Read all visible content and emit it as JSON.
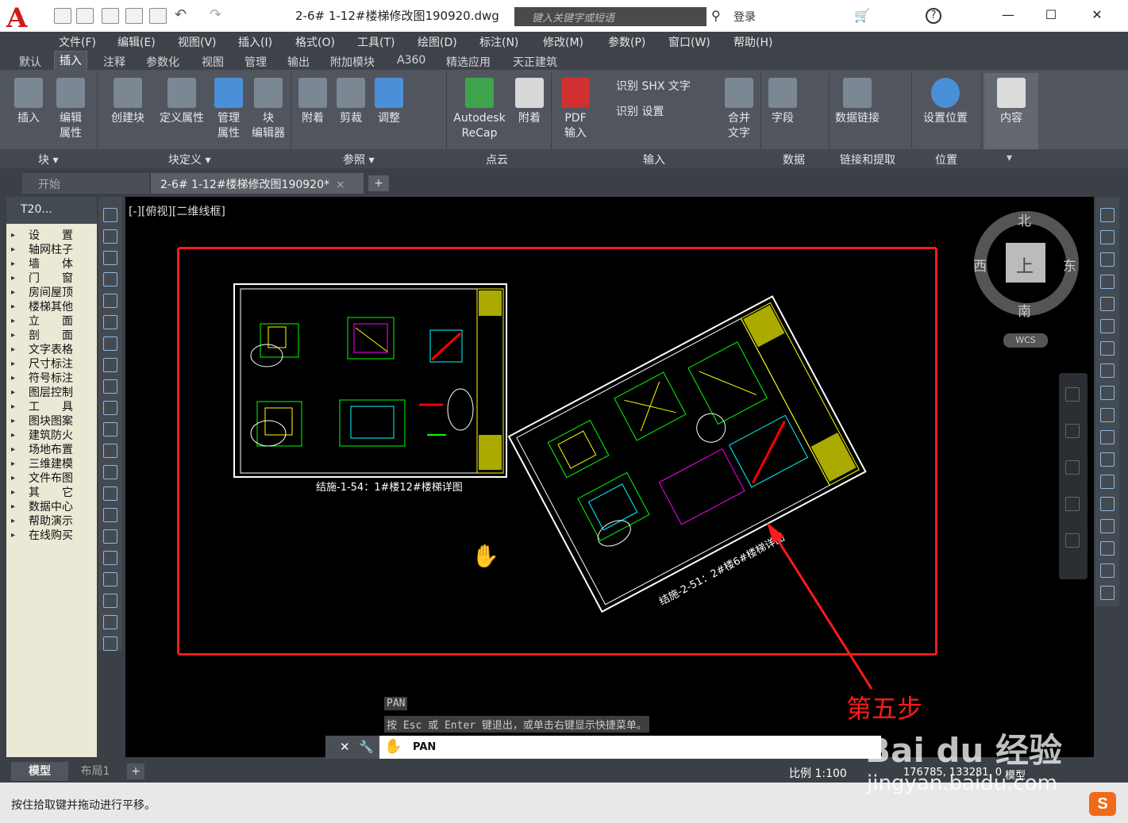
{
  "titlebar": {
    "doc_title": "2-6# 1-12#楼梯修改图190920.dwg",
    "search_placeholder": "键入关键字或短语",
    "signin": "登录"
  },
  "menubar": [
    "文件(F)",
    "编辑(E)",
    "视图(V)",
    "插入(I)",
    "格式(O)",
    "工具(T)",
    "绘图(D)",
    "标注(N)",
    "修改(M)",
    "参数(P)",
    "窗口(W)",
    "帮助(H)"
  ],
  "ribbon_tabs": [
    "默认",
    "插入",
    "注释",
    "参数化",
    "视图",
    "管理",
    "输出",
    "附加模块",
    "A360",
    "精选应用",
    "天正建筑"
  ],
  "ribbon": {
    "insert": "插入",
    "edit_attr": "编辑\n属性",
    "create_block": "创建块",
    "define_attr": "定义属性",
    "manage_attr": "管理\n属性",
    "block_editor": "块\n编辑器",
    "attach": "附着",
    "clip": "剪裁",
    "adjust": "调整",
    "recap": "Autodesk\nReCap",
    "attach2": "附着",
    "pdf_import": "PDF\n输入",
    "shx1": "识别 SHX 文字",
    "shx2": "识别 设置",
    "merge_text": "合并\n文字",
    "field": "字段",
    "data_link": "数据链接",
    "set_location": "设置位置",
    "content": "内容"
  },
  "panels": {
    "block": "块 ▾",
    "block_def": "块定义 ▾",
    "reference": "参照 ▾",
    "pointcloud": "点云",
    "import": "输入",
    "data": "数据",
    "link": "链接和提取",
    "location": "位置"
  },
  "doctabs": {
    "start": "开始",
    "file": "2-6# 1-12#楼梯修改图190920*"
  },
  "palette": {
    "title": "T20...",
    "items": [
      "设　　置",
      "轴网柱子",
      "墙　　体",
      "门　　窗",
      "房间屋顶",
      "楼梯其他",
      "立　　面",
      "剖　　面",
      "文字表格",
      "尺寸标注",
      "符号标注",
      "图层控制",
      "工　　具",
      "图块图案",
      "建筑防火",
      "场地布置",
      "三维建模",
      "文件布图",
      "其　　它",
      "数据中心",
      "帮助演示",
      "在线购买"
    ]
  },
  "canvas": {
    "viewlabel": "[-][俯视][二维线框]",
    "sheet1_caption": "结施-1-54：1#楼12#楼梯详图",
    "sheet2_caption": "结施-2-51：2#楼6#楼梯详图"
  },
  "viewcube": {
    "north": "北",
    "south": "南",
    "west": "西",
    "east": "东",
    "top": "上",
    "wcs": "WCS"
  },
  "command": {
    "hist1": "PAN",
    "hist2": "按 Esc 或 Enter 键退出，或单击右键显示快捷菜单。",
    "current": "PAN"
  },
  "layout": {
    "model": "模型",
    "layout1": "布局1",
    "scale": "比例 1:100",
    "coords": "176785, 133281, 0",
    "model2": "模型"
  },
  "status": "按住拾取键并拖动进行平移。",
  "annotation": "第五步",
  "watermark": {
    "line1": "Bai du 经验",
    "line2": "jingyan.baidu.com"
  },
  "colors": {
    "accent": "#ff1a1a",
    "canvas": "#000000"
  }
}
